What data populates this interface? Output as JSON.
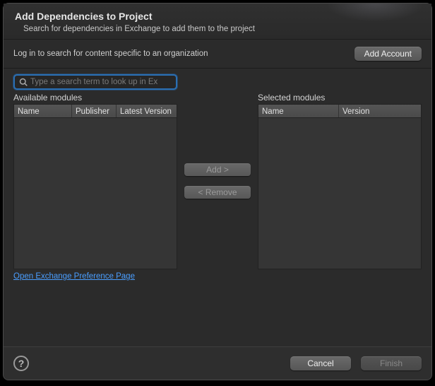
{
  "header": {
    "title": "Add Dependencies to Project",
    "subtitle": "Search for dependencies in Exchange to add them to the project"
  },
  "org": {
    "text": "Log in to search for content specific to an organization",
    "addAccount": "Add Account"
  },
  "search": {
    "placeholder": "Type a search term to look up in Ex"
  },
  "available": {
    "label": "Available modules",
    "cols": {
      "name": "Name",
      "publisher": "Publisher",
      "latest": "Latest Version"
    },
    "rows": []
  },
  "selected": {
    "label": "Selected modules",
    "cols": {
      "name": "Name",
      "version": "Version"
    },
    "rows": []
  },
  "transfer": {
    "add": "Add >",
    "remove": "< Remove"
  },
  "link": "Open Exchange Preference Page",
  "footer": {
    "cancel": "Cancel",
    "finish": "Finish"
  }
}
